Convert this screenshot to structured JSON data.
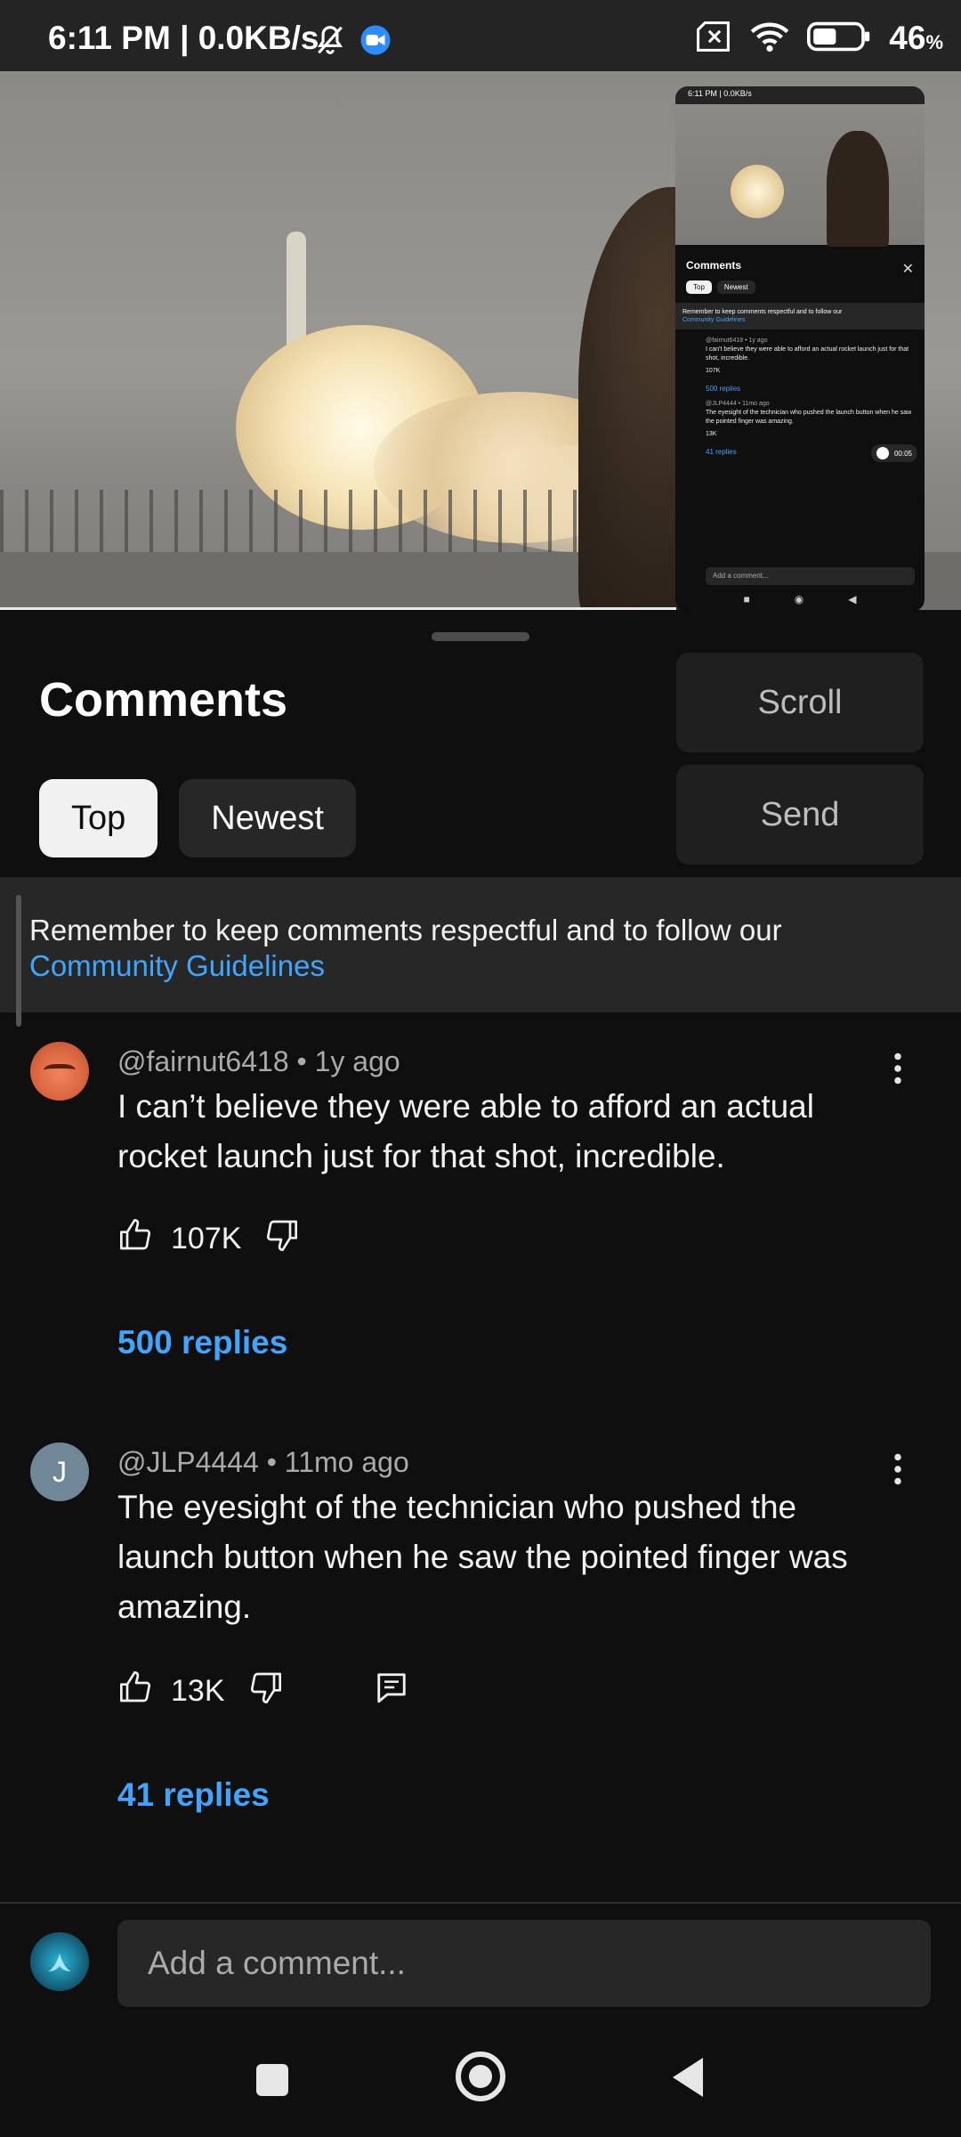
{
  "status_bar": {
    "time": "6:11 PM | 0.0KB/s",
    "battery": "46",
    "battery_unit": "%"
  },
  "mini_preview": {
    "status_text": "6:11 PM | 0.0KB/s",
    "title": "Comments",
    "tabs": [
      "Top",
      "Newest"
    ],
    "note": "Remember to keep comments respectful and to follow our",
    "note_link": "Community Guidelines",
    "comment1_meta": "@fairnut6418 • 1y ago",
    "comment1_text": "I can't believe they were able to afford an actual rocket launch just for that shot, incredible.",
    "comment1_likes": "107K",
    "comment1_replies": "500 replies",
    "comment2_meta": "@JLP4444 • 11mo ago",
    "comment2_text": "The eyesight of the technician who pushed the launch button when he saw the pointed finger was amazing.",
    "comment2_likes": "13K",
    "comment2_replies": "41 replies",
    "timer": "00:05",
    "add_placeholder": "Add a comment..."
  },
  "overlay": {
    "scroll_label": "Scroll",
    "send_label": "Send"
  },
  "panel": {
    "title": "Comments",
    "tabs": [
      {
        "label": "Top",
        "active": true
      },
      {
        "label": "Newest",
        "active": false
      }
    ]
  },
  "guidelines": {
    "text": "Remember to keep comments respectful and to follow our",
    "link": "Community Guidelines"
  },
  "comments": [
    {
      "author": "@fairnut6418",
      "age": "1y ago",
      "meta": "@fairnut6418 • 1y ago",
      "text": "I can’t believe they were able to afford an actual rocket launch just for that shot, incredible.",
      "likes": "107K",
      "replies": "500 replies"
    },
    {
      "author": "@JLP4444",
      "age": "11mo ago",
      "meta": "@JLP4444 • 11mo ago",
      "avatar_letter": "J",
      "text": "The eyesight of the technician who pushed the launch button when he saw the pointed finger was amazing.",
      "likes": "13K",
      "replies": "41 replies"
    }
  ],
  "add_comment": {
    "placeholder": "Add a comment..."
  },
  "colors": {
    "background": "#0f0f0f",
    "link": "#3ea6ff",
    "chip_active": "#f1f1f1",
    "chip": "#272727"
  }
}
